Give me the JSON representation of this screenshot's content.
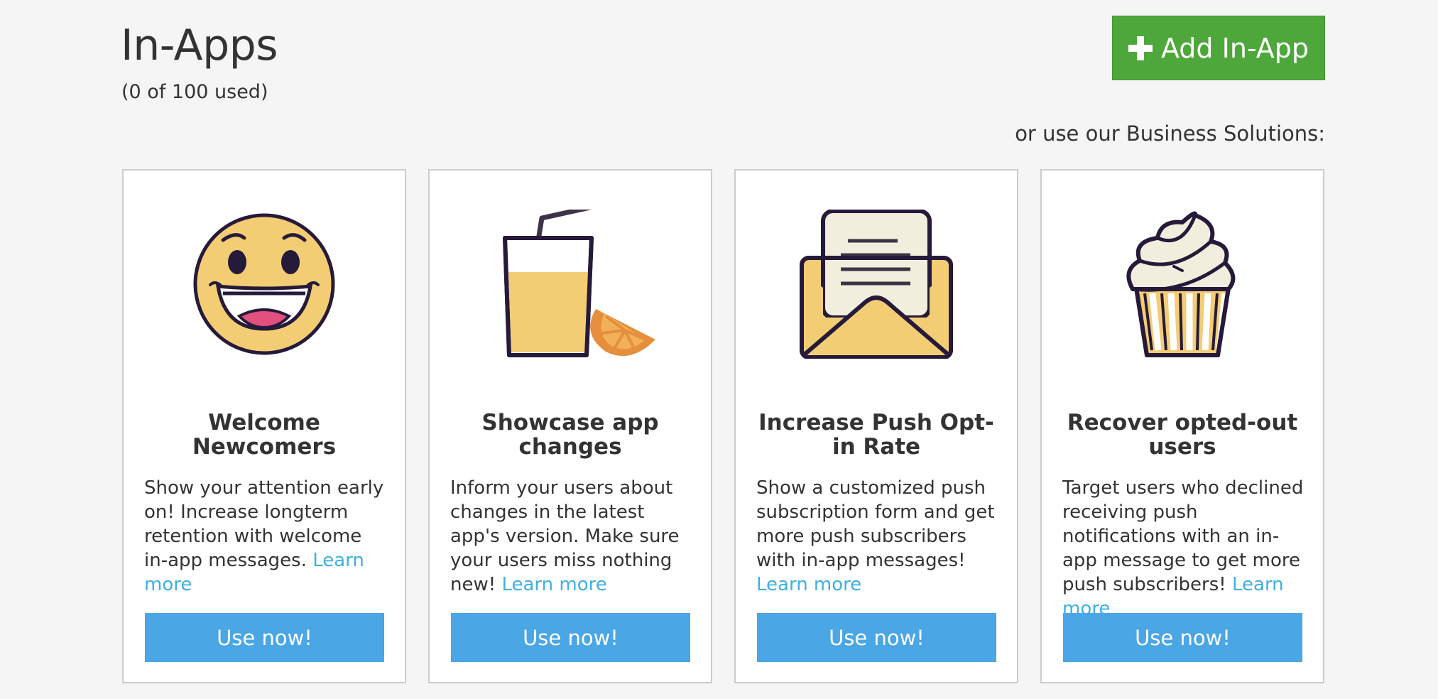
{
  "header": {
    "title": "In-Apps",
    "usage": "(0 of 100 used)",
    "add_button_label": "Add In-App",
    "business_solutions_label": "or use our Business Solutions:"
  },
  "colors": {
    "add_button": "#4ea73a",
    "use_button": "#4aa6e5",
    "link": "#3fb0e3",
    "illustration_yellow": "#f3cd74",
    "illustration_outline": "#261a3a"
  },
  "cards": [
    {
      "icon": "smiley-face-icon",
      "title": "Welcome Newcomers",
      "description": "Show your attention early on! Increase longterm retention with welcome in-app messages.",
      "link": "Learn more",
      "button": "Use now!"
    },
    {
      "icon": "juice-glass-icon",
      "title": "Showcase app changes",
      "description": "Inform your users about changes in the latest app's version. Make sure your users miss nothing new!",
      "link": "Learn more",
      "button": "Use now!"
    },
    {
      "icon": "envelope-letter-icon",
      "title": "Increase Push Opt-in Rate",
      "description": "Show a customized push subscription form and get more push subscribers with in-app messages!",
      "link": "Learn more",
      "button": "Use now!"
    },
    {
      "icon": "cupcake-icon",
      "title": "Recover opted-out users",
      "description": "Target users who declined receiving push notifications with an in-app message to get more push subscribers!",
      "link": "Learn more",
      "button": "Use now!"
    }
  ]
}
